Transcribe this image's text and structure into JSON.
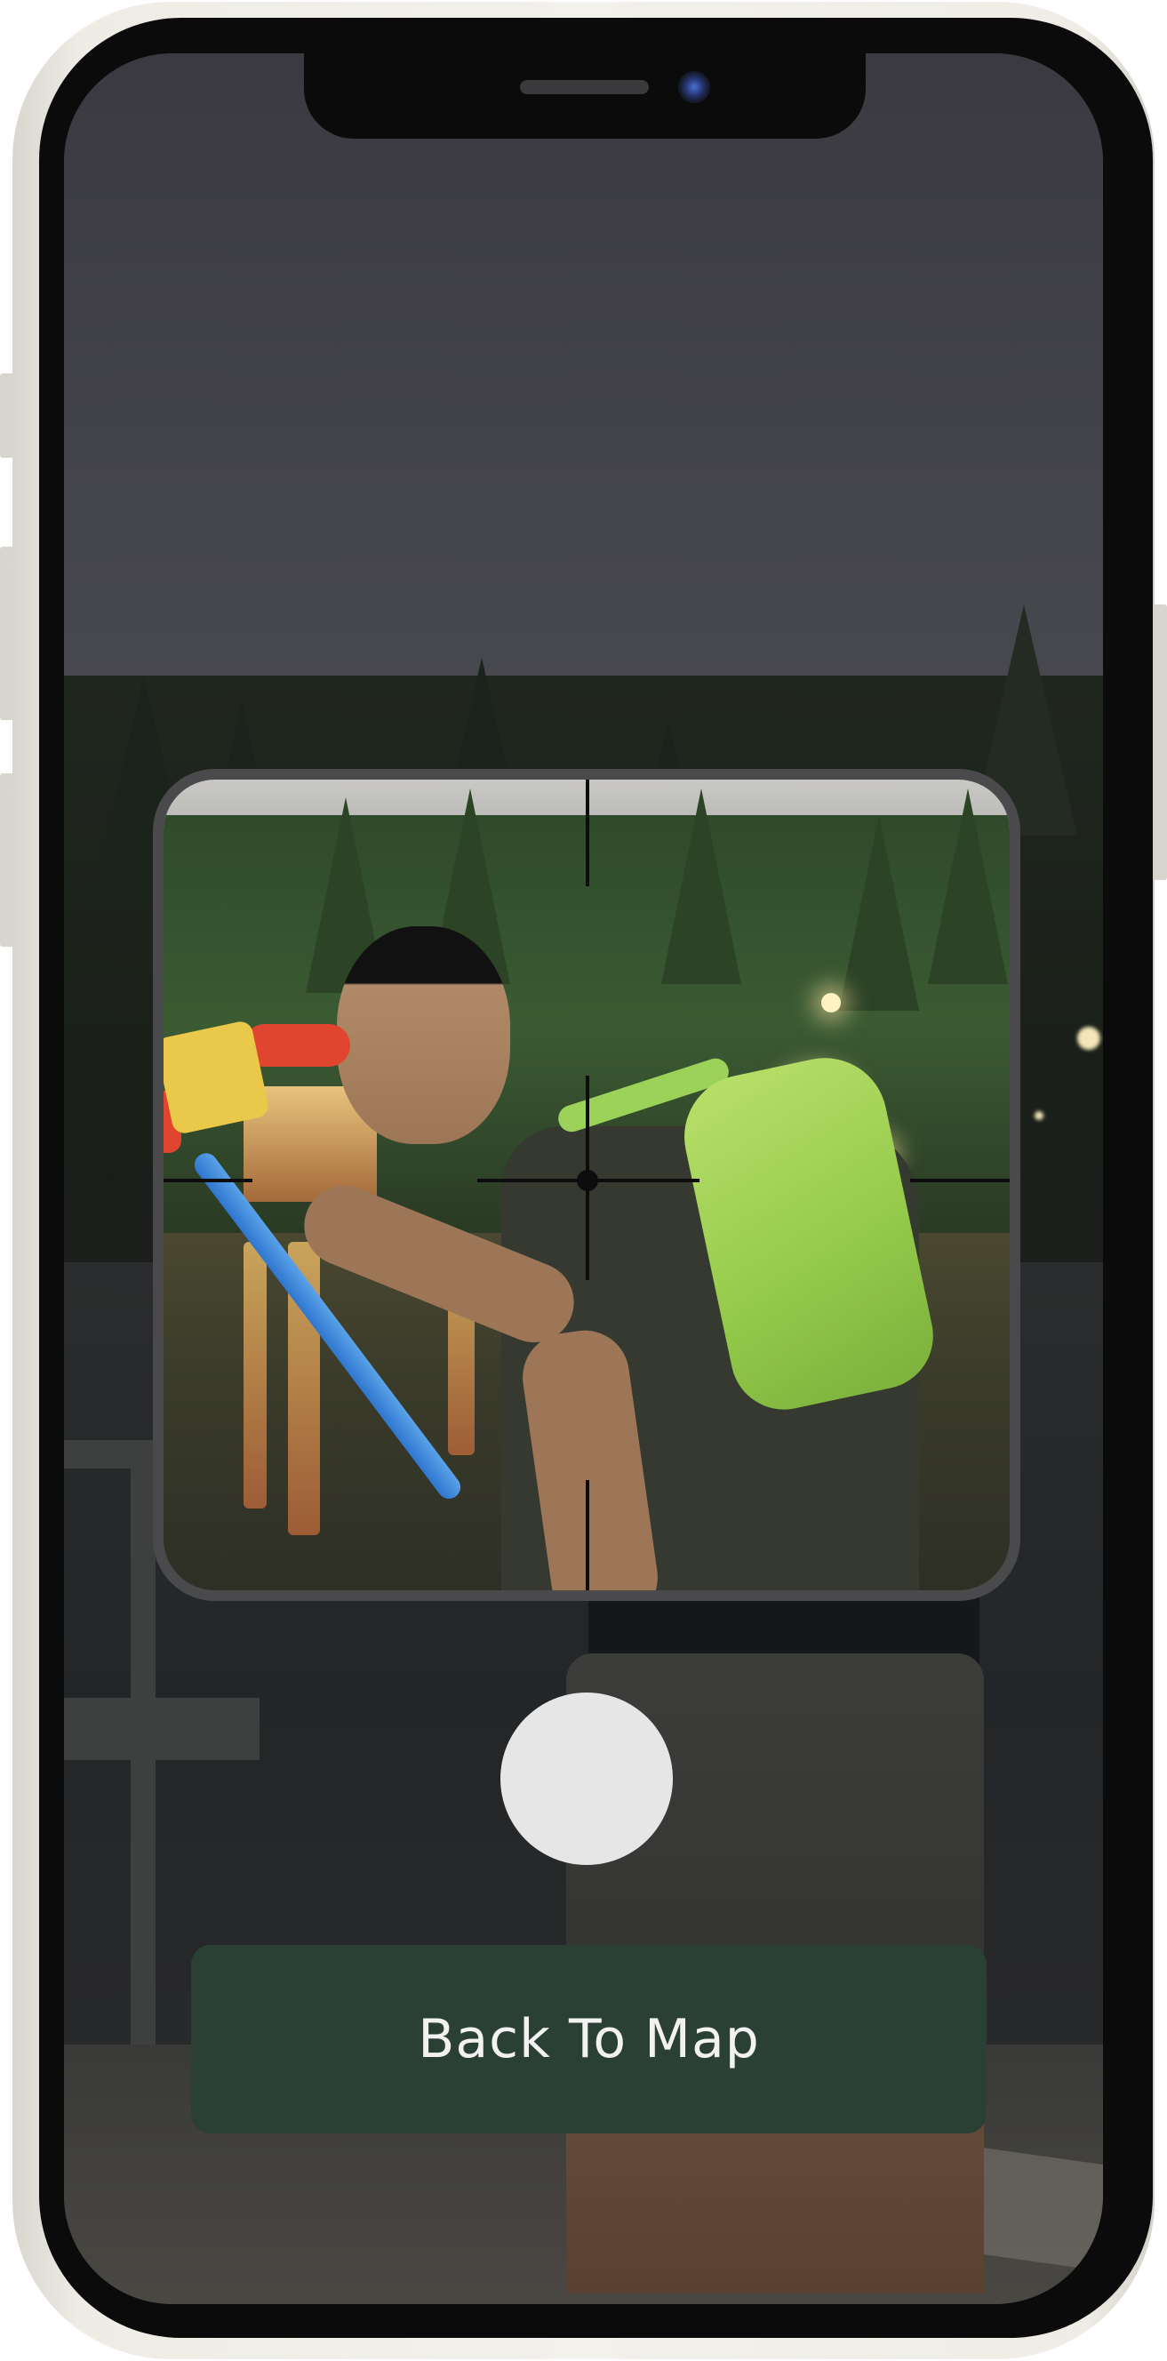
{
  "screen": {
    "background": "camera-viewfinder-night-lake-scene",
    "accent_color": "#2b4034",
    "frame_color": "#efece6"
  },
  "status": {
    "notch": "notch",
    "camera_icon": "front-camera-icon",
    "speaker_icon": "speaker-grille-icon"
  },
  "viewfinder": {
    "frame_color": "#4a4a4c",
    "crosshair": "crosshair-reticle-icon",
    "photo": "person-with-toy-hammer-photo"
  },
  "controls": {
    "shutter_color": "#e6e6e6",
    "shutter_icon": "shutter-button-icon",
    "back_to_map_label": "Back To Map",
    "back_to_map_color": "#2b4034"
  }
}
